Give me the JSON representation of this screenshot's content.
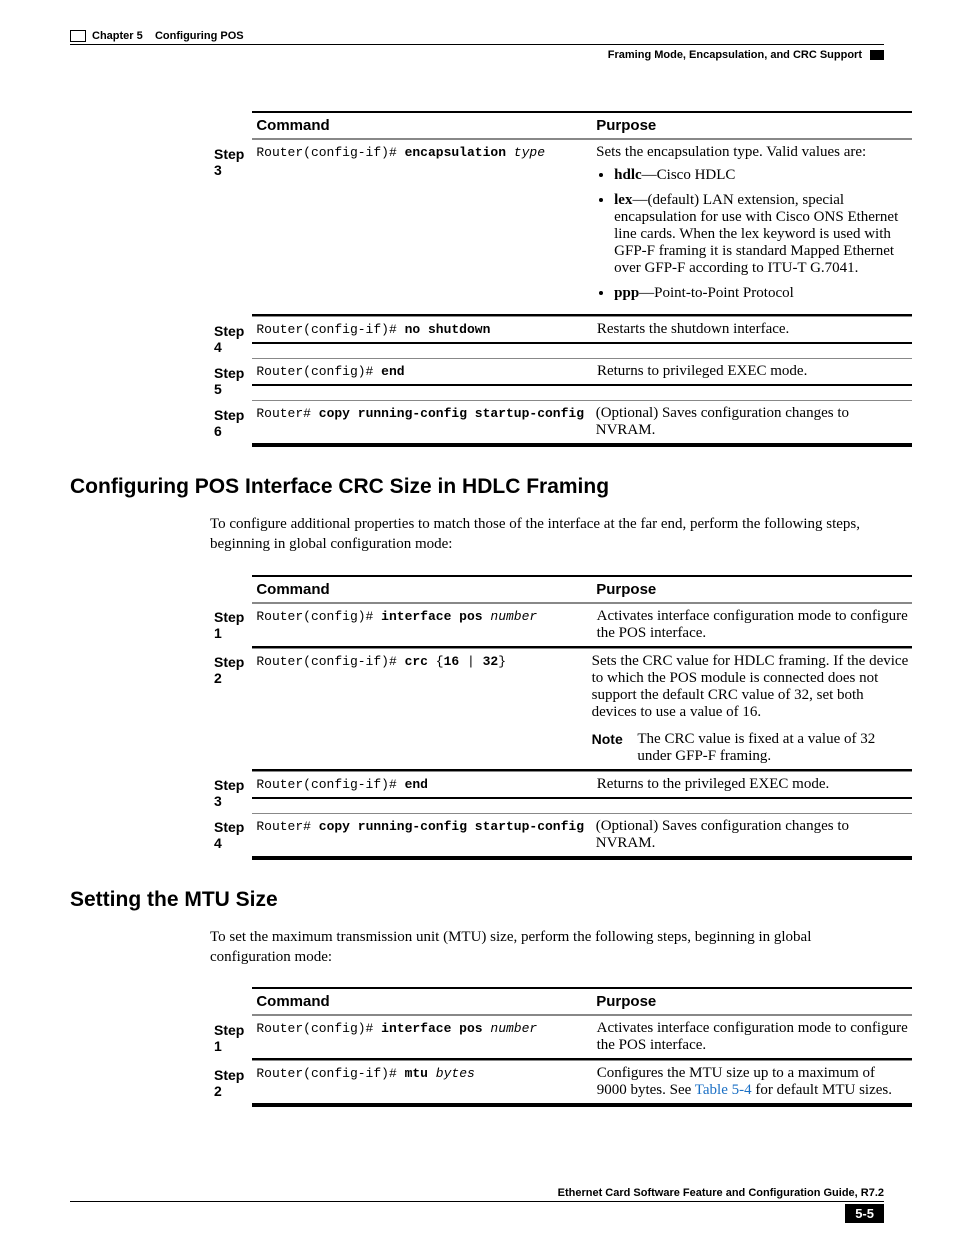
{
  "header": {
    "chapter": "Chapter 5",
    "chapter_title": "Configuring POS",
    "section_title": "Framing Mode, Encapsulation, and CRC Support"
  },
  "table1": {
    "head_command": "Command",
    "head_purpose": "Purpose",
    "rows": {
      "r3": {
        "step": "Step 3",
        "prompt": "Router(config-if)# ",
        "cmd": "encapsulation ",
        "arg": "type",
        "purpose_intro": "Sets the encapsulation type. Valid values are:",
        "b1_bold": "hdlc",
        "b1_rest": "—Cisco HDLC",
        "b2_bold": "lex",
        "b2_rest": "—(default) LAN extension, special encapsulation for use with Cisco ONS Ethernet line cards. When the lex keyword is used with GFP-F framing it is standard Mapped Ethernet over GFP-F according to ITU-T G.7041.",
        "b3_bold": "ppp",
        "b3_rest": "—Point-to-Point Protocol"
      },
      "r4": {
        "step": "Step 4",
        "prompt": "Router(config-if)# ",
        "cmd": "no shutdown",
        "purpose": "Restarts the shutdown interface."
      },
      "r5": {
        "step": "Step 5",
        "prompt": "Router(config)# ",
        "cmd": "end",
        "purpose": "Returns to privileged EXEC mode."
      },
      "r6": {
        "step": "Step 6",
        "prompt": "Router# ",
        "cmd": "copy running-config startup-config",
        "purpose": "(Optional) Saves configuration changes to NVRAM."
      }
    }
  },
  "section2": {
    "heading": "Configuring POS Interface CRC Size in HDLC Framing",
    "para": "To configure additional properties to match those of the interface at the far end, perform the following steps, beginning in global configuration mode:"
  },
  "table2": {
    "head_command": "Command",
    "head_purpose": "Purpose",
    "rows": {
      "r1": {
        "step": "Step 1",
        "prompt": "Router(config)# ",
        "cmd": "interface pos ",
        "arg": "number",
        "purpose": "Activates interface configuration mode to configure the POS interface."
      },
      "r2": {
        "step": "Step 2",
        "prompt": "Router(config-if)# ",
        "cmd": "crc ",
        "braces": "{",
        "opt1": "16",
        "sep": " | ",
        "opt2": "32",
        "braces_end": "}",
        "purpose": "Sets the CRC value for HDLC framing. If the device to which the POS module is connected does not support the default CRC value of 32, set both devices to use a value of 16.",
        "note_label": "Note",
        "note_body": "The CRC value is fixed at a value of 32 under GFP-F framing."
      },
      "r3": {
        "step": "Step 3",
        "prompt": "Router(config-if)# ",
        "cmd": "end",
        "purpose": "Returns to the privileged EXEC mode."
      },
      "r4": {
        "step": "Step 4",
        "prompt": "Router# ",
        "cmd": "copy running-config startup-config",
        "purpose": "(Optional) Saves configuration changes to NVRAM."
      }
    }
  },
  "section3": {
    "heading": "Setting the MTU Size",
    "para": "To set the maximum transmission unit (MTU) size, perform the following steps, beginning in global configuration mode:"
  },
  "table3": {
    "head_command": "Command",
    "head_purpose": "Purpose",
    "rows": {
      "r1": {
        "step": "Step 1",
        "prompt": "Router(config)# ",
        "cmd": "interface pos ",
        "arg": "number",
        "purpose": "Activates interface configuration mode to configure the POS interface."
      },
      "r2": {
        "step": "Step 2",
        "prompt": "Router(config-if)# ",
        "cmd": "mtu ",
        "arg": "bytes",
        "purpose_pre": "Configures the MTU size up to a maximum of 9000 bytes. See ",
        "purpose_link": "Table 5-4",
        "purpose_post": " for default MTU sizes."
      }
    }
  },
  "footer": {
    "title": "Ethernet Card Software Feature and Configuration Guide, R7.2",
    "page": "5-5"
  }
}
